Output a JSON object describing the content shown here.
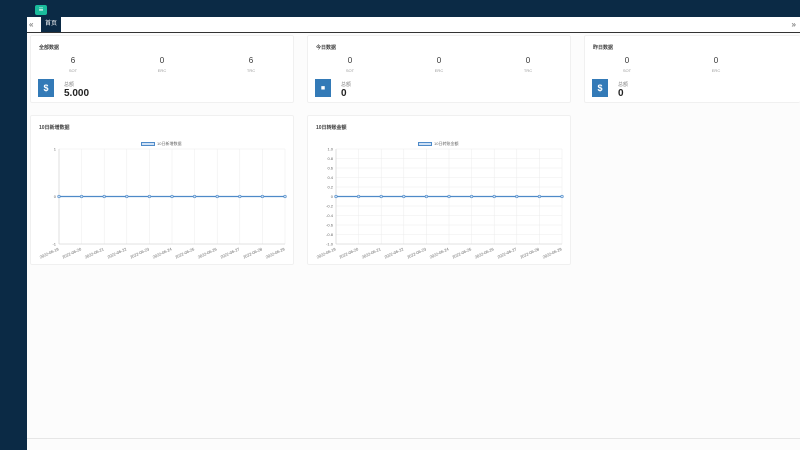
{
  "header": {
    "menu_icon": "≡"
  },
  "tabs": {
    "prev": "«",
    "next": "»",
    "active_label": "首页"
  },
  "cards": {
    "all": {
      "title": "全部数据",
      "stats": [
        {
          "value": "6",
          "label": "SOT"
        },
        {
          "value": "0",
          "label": "ERC"
        },
        {
          "value": "6",
          "label": "TRC"
        }
      ],
      "icon": "$",
      "total_label": "总额",
      "total_value": "5.000"
    },
    "today": {
      "title": "今日数据",
      "stats": [
        {
          "value": "0",
          "label": "SOT"
        },
        {
          "value": "0",
          "label": "ERC"
        },
        {
          "value": "0",
          "label": "TRC"
        }
      ],
      "icon": "■",
      "total_label": "总额",
      "total_value": "0"
    },
    "yesterday": {
      "title": "昨日数据",
      "stats": [
        {
          "value": "0",
          "label": "SOT"
        },
        {
          "value": "0",
          "label": "ERC"
        }
      ],
      "icon": "$",
      "total_label": "总额",
      "total_value": "0"
    }
  },
  "chart_data": [
    {
      "type": "line",
      "title": "10日新增数据",
      "legend": "10日新增数据",
      "x": [
        "2022-06-19",
        "2022-06-20",
        "2022-06-21",
        "2022-06-22",
        "2022-06-23",
        "2022-06-24",
        "2022-06-25",
        "2022-06-26",
        "2022-06-27",
        "2022-06-28",
        "2022-06-29"
      ],
      "series": [
        {
          "name": "10日新增数据",
          "values": [
            0,
            0,
            0,
            0,
            0,
            0,
            0,
            0,
            0,
            0,
            0
          ]
        }
      ],
      "ylim": [
        -1,
        1
      ],
      "yticks": [
        "1",
        "0",
        "-1"
      ],
      "grid": true,
      "legend_position": "top-center",
      "line_color": "#4e8ac8"
    },
    {
      "type": "line",
      "title": "10日转账金额",
      "legend": "10日转账金额",
      "x": [
        "2022-06-19",
        "2022-06-20",
        "2022-06-21",
        "2022-06-22",
        "2022-06-23",
        "2022-06-24",
        "2022-06-25",
        "2022-06-26",
        "2022-06-27",
        "2022-06-28",
        "2022-06-29"
      ],
      "series": [
        {
          "name": "10日转账金额",
          "values": [
            0,
            0,
            0,
            0,
            0,
            0,
            0,
            0,
            0,
            0,
            0
          ]
        }
      ],
      "ylim": [
        -1,
        1
      ],
      "yticks": [
        "1.0",
        "0.8",
        "0.6",
        "0.4",
        "0.2",
        "0",
        "-0.2",
        "-0.4",
        "-0.6",
        "-0.8",
        "-1.0"
      ],
      "grid": true,
      "legend_position": "top-center",
      "line_color": "#4e8ac8"
    }
  ]
}
